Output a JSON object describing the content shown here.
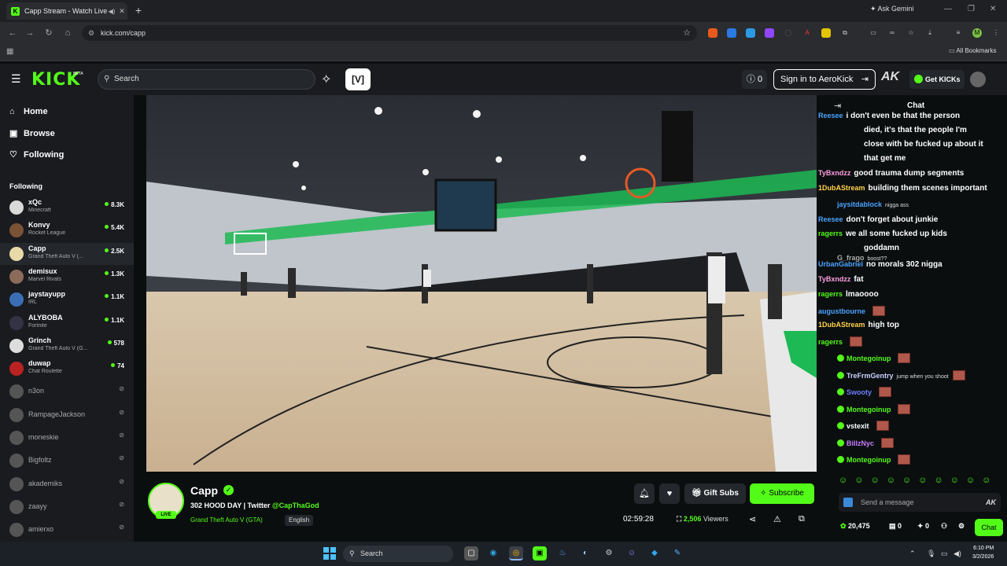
{
  "browser": {
    "tab_title": "Capp Stream - Watch Live ...",
    "url": "kick.com/capp",
    "ask_gemini": "Ask Gemini",
    "all_bookmarks": "All Bookmarks"
  },
  "header": {
    "logo": "KICK",
    "logo_sup": "BETA",
    "search_placeholder": "Search",
    "notification_count": "0",
    "signin": "Sign in to AeroKick",
    "ak": "AK",
    "get_kicks": "Get KICKs"
  },
  "sidebar": {
    "nav": [
      {
        "label": "Home",
        "icon": "home-icon"
      },
      {
        "label": "Browse",
        "icon": "browse-icon"
      },
      {
        "label": "Following",
        "icon": "heart-icon"
      }
    ],
    "following_heading": "Following",
    "channels": [
      {
        "name": "xQc",
        "game": "Minecraft",
        "viewers": "8.3K",
        "live": true,
        "color": "#d9d9d9"
      },
      {
        "name": "Konvy",
        "game": "Rocket League",
        "viewers": "5.4K",
        "live": true,
        "color": "#7a5236"
      },
      {
        "name": "Capp",
        "game": "Grand Theft Auto V (...",
        "viewers": "2.5K",
        "live": true,
        "color": "#e8d9a8"
      },
      {
        "name": "demisux",
        "game": "Marvel Rivals",
        "viewers": "1.3K",
        "live": true,
        "color": "#8c6b5a"
      },
      {
        "name": "jaystayupp",
        "game": "IRL",
        "viewers": "1.1K",
        "live": true,
        "color": "#3b6fb5"
      },
      {
        "name": "ALYBOBA",
        "game": "Fortnite",
        "viewers": "1.1K",
        "live": true,
        "color": "#334"
      },
      {
        "name": "Grinch",
        "game": "Grand Theft Auto V (G...",
        "viewers": "578",
        "live": true,
        "color": "#ddd"
      },
      {
        "name": "duwap",
        "game": "Chat Roulette",
        "viewers": "74",
        "live": true,
        "color": "#b22"
      },
      {
        "name": "n3on",
        "game": "",
        "viewers": "",
        "live": false,
        "color": "#555"
      },
      {
        "name": "RampageJackson",
        "game": "",
        "viewers": "",
        "live": false,
        "color": "#555"
      },
      {
        "name": "moneskie",
        "game": "",
        "viewers": "",
        "live": false,
        "color": "#555"
      },
      {
        "name": "Bigfoltz",
        "game": "",
        "viewers": "",
        "live": false,
        "color": "#555"
      },
      {
        "name": "akademiks",
        "game": "",
        "viewers": "",
        "live": false,
        "color": "#555"
      },
      {
        "name": "zaayy",
        "game": "",
        "viewers": "",
        "live": false,
        "color": "#555"
      },
      {
        "name": "amierxo",
        "game": "",
        "viewers": "",
        "live": false,
        "color": "#555"
      }
    ]
  },
  "stream": {
    "channel": "Capp",
    "live_label": "LIVE",
    "title_prefix": "302 HOOD DAY | Twitter ",
    "twitter": "@CapThaGod",
    "category": "Grand Theft Auto V (GTA)",
    "language": "English",
    "gift_subs": "Gift Subs",
    "subscribe": "Subscribe",
    "uptime": "02:59:28",
    "viewers_count": "2,506",
    "viewers_label": "Viewers"
  },
  "chat": {
    "title": "Chat",
    "messages": [
      {
        "user": "Reesee",
        "text": "i don't even be that the person",
        "color": "#4aa3ff",
        "size": "lg"
      },
      {
        "user": "",
        "text": "died, it's that the people I'm",
        "color": "#fff",
        "size": "lg"
      },
      {
        "user": "",
        "text": "close with be fucked up about it",
        "color": "#fff",
        "size": "lg"
      },
      {
        "user": "",
        "text": "that get me",
        "color": "#fff",
        "size": "lg"
      },
      {
        "user": "TyBxndzz",
        "text": "good trauma dump segments",
        "color": "#ff9de2",
        "size": "lg"
      },
      {
        "user": "1DubAStream",
        "text": "building them scenes important",
        "color": "#ffd24a",
        "size": "lg"
      },
      {
        "user": "jaysitdablock",
        "text": "nigga ass",
        "color": "#4aa3ff",
        "size": "sm"
      },
      {
        "user": "Reesee",
        "text": "don't forget about junkie",
        "color": "#4aa3ff",
        "size": "lg"
      },
      {
        "user": "ragerrs",
        "text": "we all some fucked up kids",
        "color": "#53fc18",
        "size": "lg"
      },
      {
        "user": "",
        "text": "goddamn",
        "color": "#fff",
        "size": "lg"
      },
      {
        "user": "G_frago",
        "text": "boost??",
        "color": "#aaa",
        "size": "sm"
      },
      {
        "user": "UrbanGabriel",
        "text": "no morals 302 nigga",
        "color": "#4aa3ff",
        "size": "lg"
      },
      {
        "user": "TyBxndzz",
        "text": "fat",
        "color": "#ff9de2",
        "size": "lg"
      },
      {
        "user": "ragerrs",
        "text": "lmaoooo",
        "color": "#53fc18",
        "size": "lg"
      },
      {
        "user": "augustbourne",
        "text": "",
        "color": "#4aa3ff",
        "size": "lg"
      },
      {
        "user": "1DubAStream",
        "text": "high top",
        "color": "#ffd24a",
        "size": "lg"
      },
      {
        "user": "ragerrs",
        "text": "",
        "color": "#53fc18",
        "size": "lg"
      },
      {
        "user": "Montegoinup",
        "text": "",
        "color": "#53fc18",
        "size": "sm"
      },
      {
        "user": "TreFrmGentry",
        "text": "jump when you shoot",
        "color": "#c8d0ff",
        "size": "sm"
      },
      {
        "user": "Swooty",
        "text": "",
        "color": "#6f7dff",
        "size": "sm"
      },
      {
        "user": "Montegoinup",
        "text": "",
        "color": "#53fc18",
        "size": "sm"
      },
      {
        "user": "vstexit",
        "text": "",
        "color": "#fff",
        "size": "sm"
      },
      {
        "user": "BillzNyc",
        "text": "",
        "color": "#c77dff",
        "size": "sm"
      },
      {
        "user": "Montegoinup",
        "text": "",
        "color": "#53fc18",
        "size": "sm"
      }
    ],
    "input_placeholder": "Send a message",
    "points": "20,475",
    "stat1": "0",
    "stat2": "0",
    "chat_button": "Chat"
  },
  "taskbar": {
    "search": "Search",
    "time": "6:10 PM",
    "date": "3/2/2026"
  },
  "colors": {
    "accent": "#53fc18",
    "background": "#0b0e0f",
    "panel": "#191b1f"
  }
}
